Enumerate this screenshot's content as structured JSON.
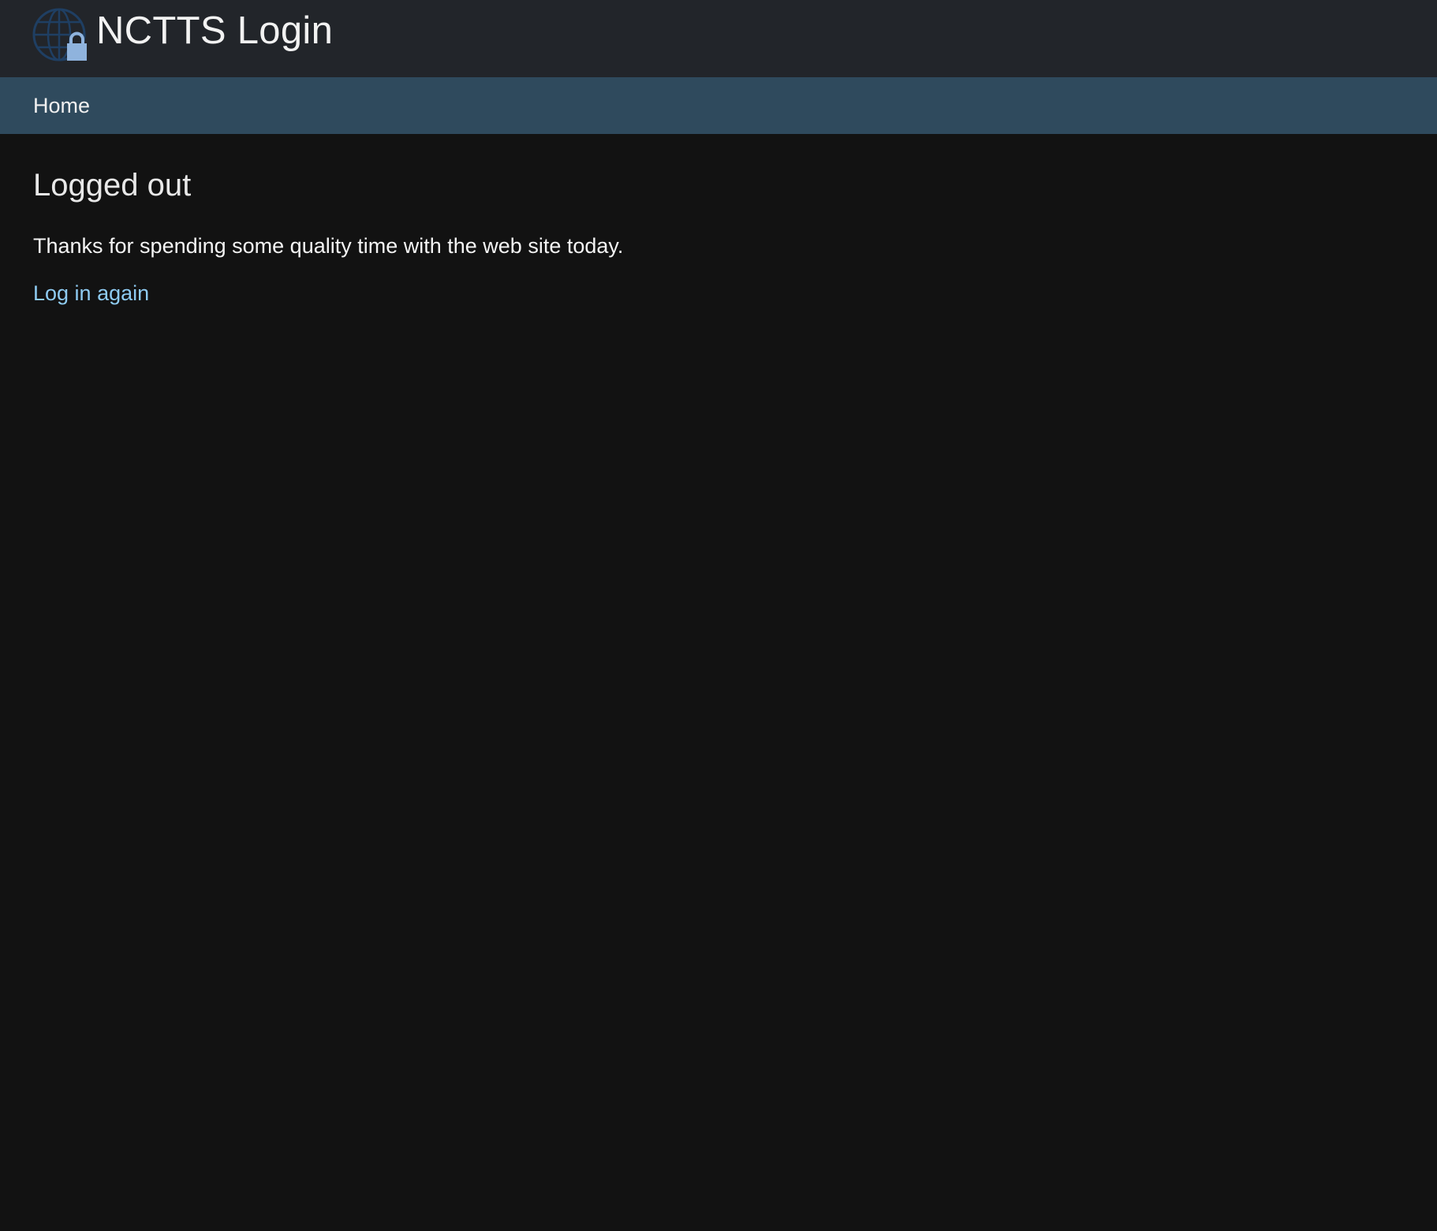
{
  "header": {
    "logo_icon": "globe-lock-icon",
    "title": "NCTTS Login"
  },
  "nav": {
    "home_label": "Home"
  },
  "main": {
    "heading": "Logged out",
    "message": "Thanks for spending some quality time with the web site today.",
    "relogin_link": "Log in again"
  },
  "colors": {
    "page_background": "#121212",
    "header_background": "#22252a",
    "nav_background": "#2f4a5d",
    "link": "#8ecbf2",
    "logo_globe": "#1f3f63",
    "logo_lock": "#8fb3dd"
  }
}
